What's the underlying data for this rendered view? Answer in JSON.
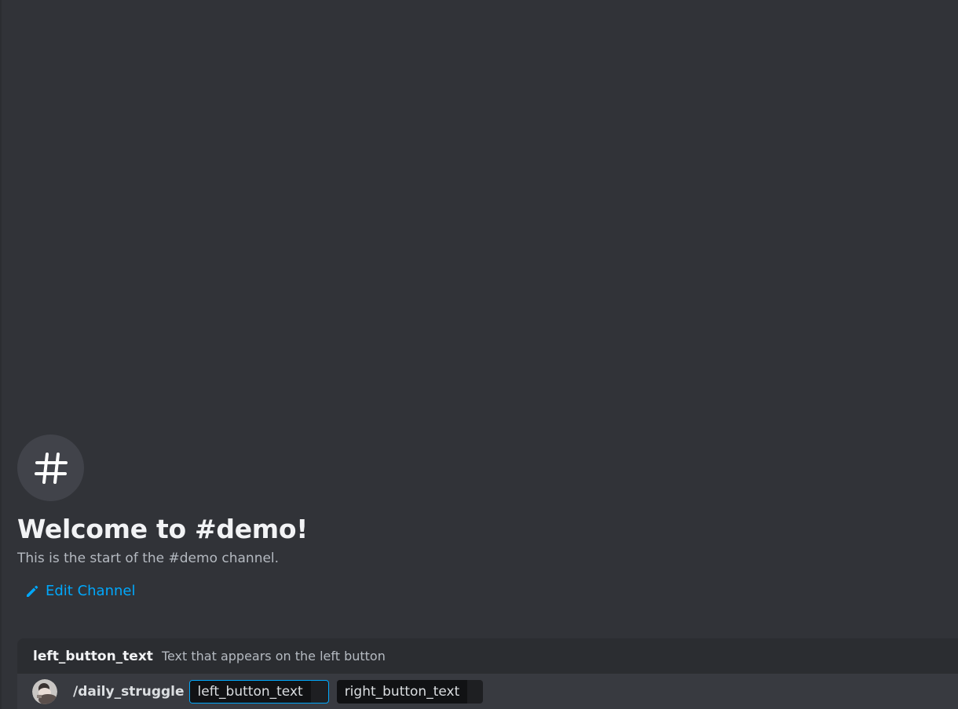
{
  "welcome": {
    "icon": "hash-icon",
    "title": "Welcome to #demo!",
    "subtitle": "This is the start of the #demo channel.",
    "edit_label": "Edit Channel",
    "edit_icon": "pencil-icon"
  },
  "option_hint": {
    "name": "left_button_text",
    "description": "Text that appears on the left button"
  },
  "command_input": {
    "avatar": "user-avatar",
    "command": "/daily_struggle",
    "params": [
      {
        "name": "left_button_text",
        "value": "",
        "active": true
      },
      {
        "name": "right_button_text",
        "value": "",
        "active": false
      }
    ]
  },
  "colors": {
    "background": "#313338",
    "link": "#00a8fc",
    "focus_border": "#00a8fc"
  }
}
